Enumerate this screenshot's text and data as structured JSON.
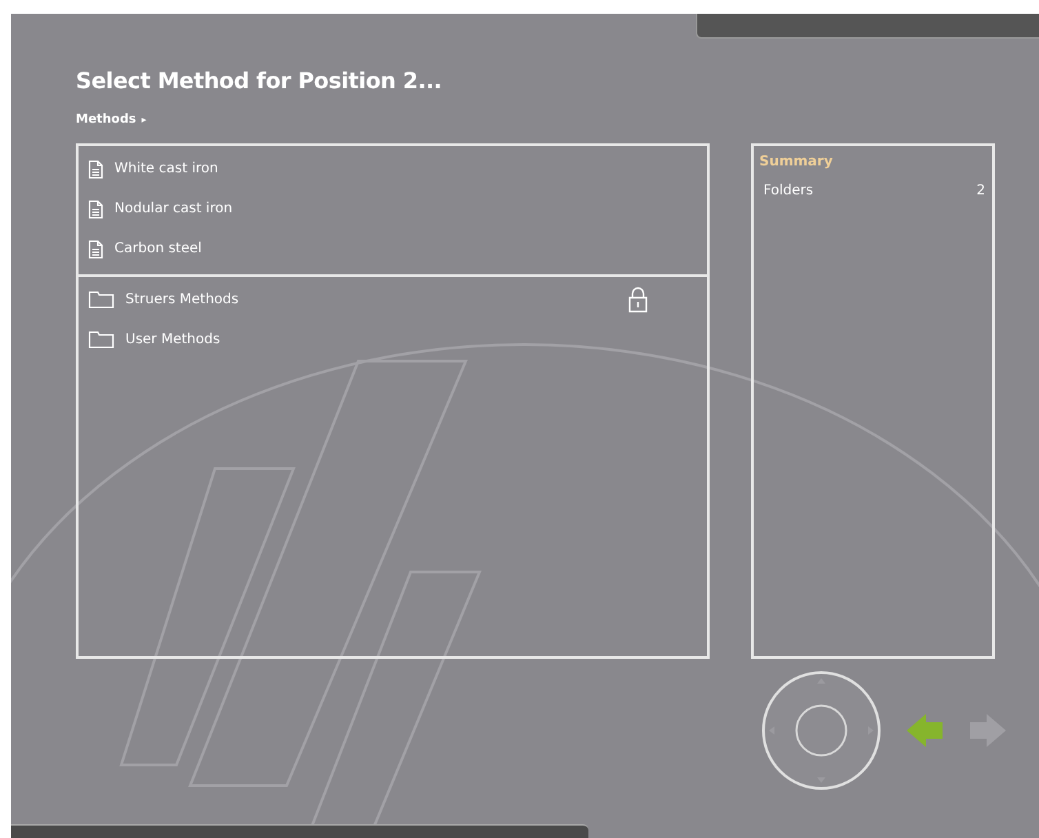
{
  "title": "Select Method for Position 2...",
  "breadcrumb": {
    "label": "Methods",
    "separator": "▸"
  },
  "methods": [
    {
      "kind": "file",
      "name": "White cast iron",
      "locked": false
    },
    {
      "kind": "file",
      "name": "Nodular cast iron",
      "locked": false
    },
    {
      "kind": "file",
      "name": "Carbon steel",
      "locked": false
    },
    {
      "kind": "folder",
      "name": "Struers Methods",
      "locked": true
    },
    {
      "kind": "folder",
      "name": "User Methods",
      "locked": false
    }
  ],
  "summary": {
    "title": "Summary",
    "rows": [
      {
        "label": "Folders",
        "value": "2"
      }
    ]
  },
  "navigation": {
    "back_enabled": true,
    "forward_enabled": false
  }
}
